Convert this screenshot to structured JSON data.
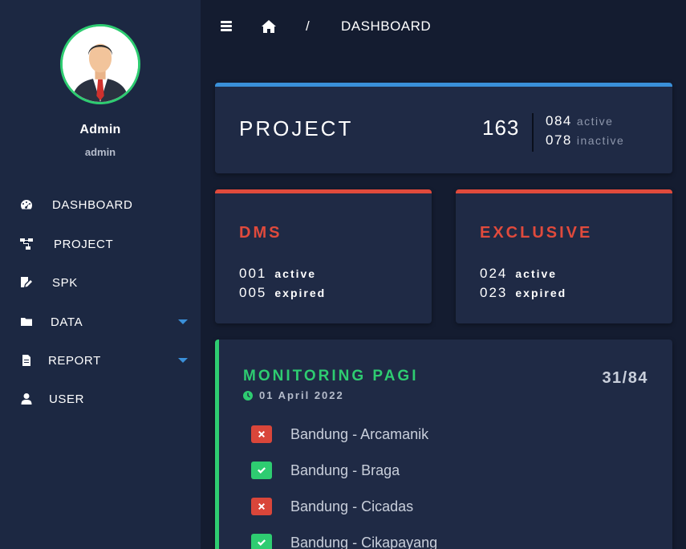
{
  "user": {
    "name": "Admin",
    "role": "admin"
  },
  "sidebar": {
    "items": [
      {
        "label": "DASHBOARD",
        "icon": "dashboard-gauge-icon",
        "has_caret": false
      },
      {
        "label": "PROJECT",
        "icon": "sitemap-icon",
        "has_caret": false
      },
      {
        "label": "SPK",
        "icon": "edit-document-icon",
        "has_caret": false
      },
      {
        "label": "DATA",
        "icon": "folder-icon",
        "has_caret": true
      },
      {
        "label": "REPORT",
        "icon": "file-icon",
        "has_caret": true
      },
      {
        "label": "USER",
        "icon": "user-icon",
        "has_caret": false
      }
    ]
  },
  "breadcrumb": {
    "separator": "/",
    "current": "DASHBOARD"
  },
  "project_card": {
    "title": "PROJECT",
    "total": "163",
    "active_count": "084",
    "active_label": "active",
    "inactive_count": "078",
    "inactive_label": "inactive"
  },
  "dms_card": {
    "title": "DMS",
    "active_count": "001",
    "active_label": "active",
    "expired_count": "005",
    "expired_label": "expired"
  },
  "exclusive_card": {
    "title": "EXCLUSIVE",
    "active_count": "024",
    "active_label": "active",
    "expired_count": "023",
    "expired_label": "expired"
  },
  "monitoring": {
    "title": "MONITORING PAGI",
    "date": "01 April 2022",
    "count": "31/84",
    "items": [
      {
        "name": "Bandung - Arcamanik",
        "status": "fail"
      },
      {
        "name": "Bandung - Braga",
        "status": "ok"
      },
      {
        "name": "Bandung - Cicadas",
        "status": "fail"
      },
      {
        "name": "Bandung - Cikapayang",
        "status": "ok"
      }
    ]
  },
  "colors": {
    "accent_blue": "#3a90d9",
    "accent_red": "#e04a3c",
    "accent_green": "#2ecc71",
    "sidebar_bg": "#1c2842",
    "page_bg": "#141c30",
    "card_bg": "#1f2a45"
  }
}
